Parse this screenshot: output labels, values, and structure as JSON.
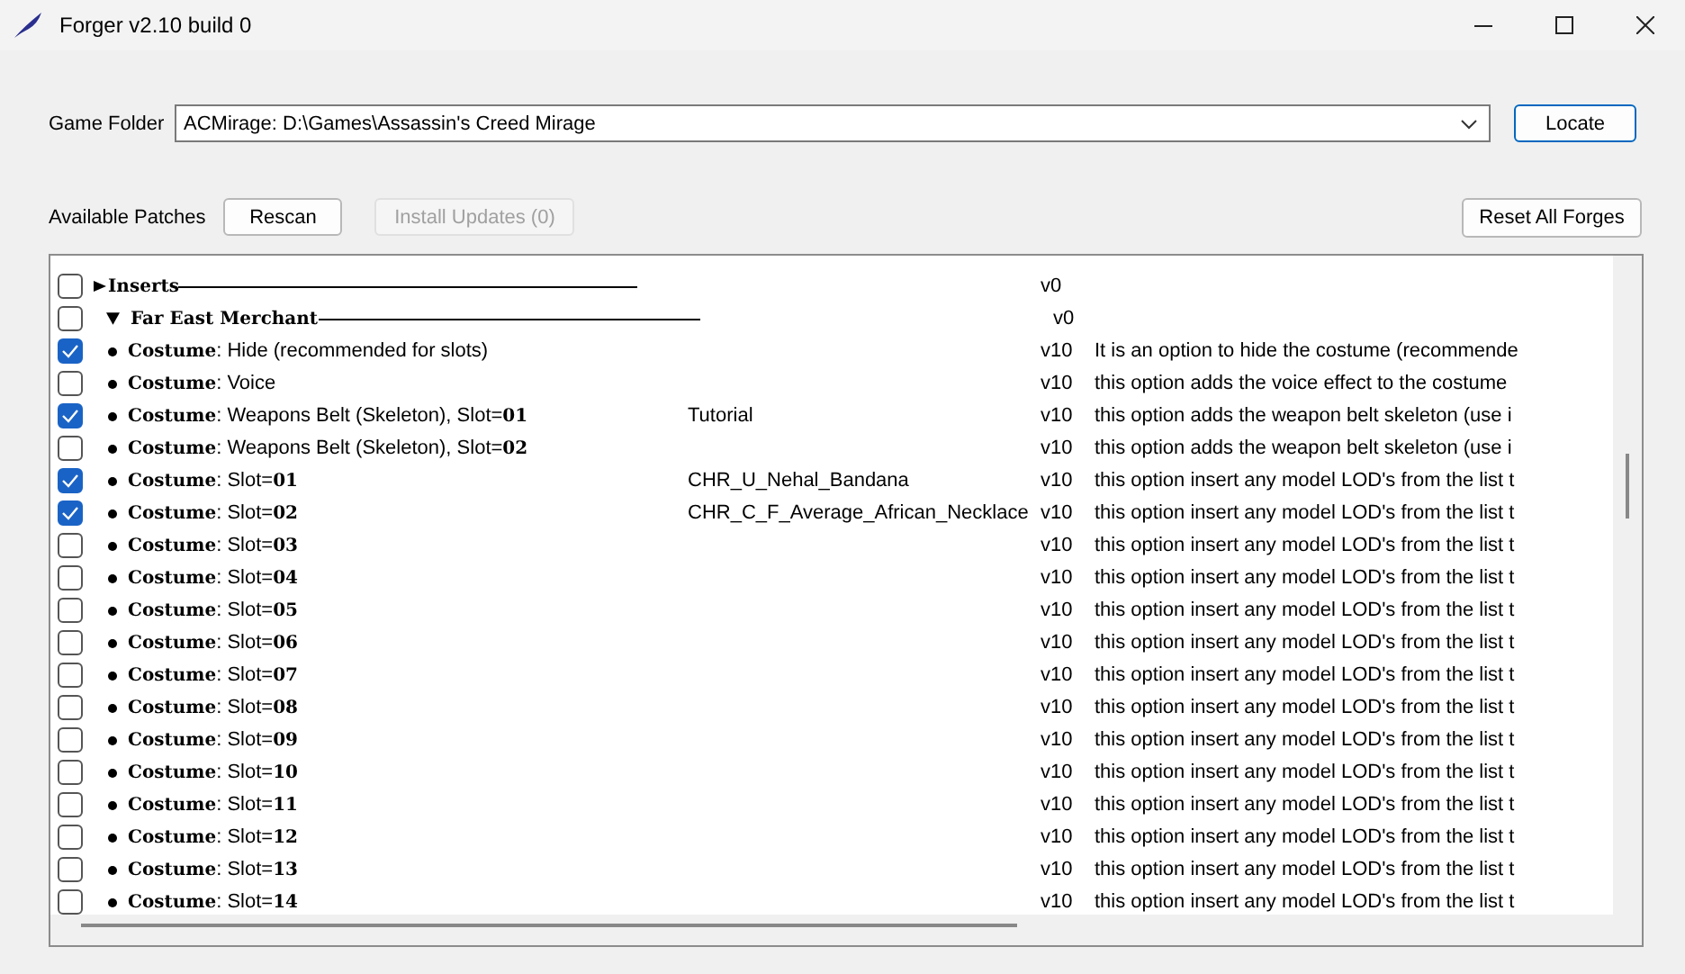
{
  "window": {
    "title": "Forger v2.10 build 0"
  },
  "game_folder": {
    "label": "Game Folder",
    "value": "ACMirage: D:\\Games\\Assassin's Creed Mirage",
    "button": "Locate"
  },
  "patches_bar": {
    "label": "Available Patches",
    "rescan": "Rescan",
    "install": {
      "label": "Install Updates (0)",
      "disabled": true
    },
    "reset": "Reset All Forges"
  },
  "patches": [
    {
      "kind": "group",
      "label": "Inserts",
      "expanded": false,
      "checked": false,
      "version": "v0"
    },
    {
      "kind": "group",
      "label": "Far East Merchant",
      "expanded": true,
      "checked": false,
      "version": "v0",
      "children": [
        {
          "kind": "option",
          "label": "**Costume**: Hide (recommended for slots)",
          "checked": true,
          "version": "v10",
          "description": "It is an option to hide the costume (recommende"
        },
        {
          "kind": "option",
          "label": "**Costume**: Voice",
          "checked": false,
          "version": "v10",
          "description": "this option adds the voice effect to the costume"
        },
        {
          "kind": "option",
          "label": "**Costume**: Weapons Belt (Skeleton), Slot=**01**",
          "checked": true,
          "value": "Tutorial",
          "version": "v10",
          "description": "this option adds the weapon belt skeleton (use i"
        },
        {
          "kind": "option",
          "label": "**Costume**: Weapons Belt (Skeleton), Slot=**02**",
          "checked": false,
          "version": "v10",
          "description": "this option adds the weapon belt skeleton (use i"
        },
        {
          "kind": "option",
          "label": "**Costume**: Slot=**01**",
          "checked": true,
          "value": "CHR_U_Nehal_Bandana",
          "version": "v10",
          "description": "this option insert any model LOD's from the list t"
        },
        {
          "kind": "option",
          "label": "**Costume**: Slot=**02**",
          "checked": true,
          "value": "CHR_C_F_Average_African_Necklace",
          "version": "v10",
          "description": "this option insert any model LOD's from the list t"
        },
        {
          "kind": "option",
          "label": "**Costume**: Slot=**03**",
          "checked": false,
          "version": "v10",
          "description": "this option insert any model LOD's from the list t"
        },
        {
          "kind": "option",
          "label": "**Costume**: Slot=**04**",
          "checked": false,
          "version": "v10",
          "description": "this option insert any model LOD's from the list t"
        },
        {
          "kind": "option",
          "label": "**Costume**: Slot=**05**",
          "checked": false,
          "version": "v10",
          "description": "this option insert any model LOD's from the list t"
        },
        {
          "kind": "option",
          "label": "**Costume**: Slot=**06**",
          "checked": false,
          "version": "v10",
          "description": "this option insert any model LOD's from the list t"
        },
        {
          "kind": "option",
          "label": "**Costume**: Slot=**07**",
          "checked": false,
          "version": "v10",
          "description": "this option insert any model LOD's from the list t"
        },
        {
          "kind": "option",
          "label": "**Costume**: Slot=**08**",
          "checked": false,
          "version": "v10",
          "description": "this option insert any model LOD's from the list t"
        },
        {
          "kind": "option",
          "label": "**Costume**: Slot=**09**",
          "checked": false,
          "version": "v10",
          "description": "this option insert any model LOD's from the list t"
        },
        {
          "kind": "option",
          "label": "**Costume**: Slot=**10**",
          "checked": false,
          "version": "v10",
          "description": "this option insert any model LOD's from the list t"
        },
        {
          "kind": "option",
          "label": "**Costume**: Slot=**11**",
          "checked": false,
          "version": "v10",
          "description": "this option insert any model LOD's from the list t"
        },
        {
          "kind": "option",
          "label": "**Costume**: Slot=**12**",
          "checked": false,
          "version": "v10",
          "description": "this option insert any model LOD's from the list t"
        },
        {
          "kind": "option",
          "label": "**Costume**: Slot=**13**",
          "checked": false,
          "version": "v10",
          "description": "this option insert any model LOD's from the list t"
        },
        {
          "kind": "option",
          "label": "**Costume**: Slot=**14**",
          "checked": false,
          "version": "v10",
          "description": "this option insert any model LOD's from the list t"
        }
      ]
    }
  ]
}
